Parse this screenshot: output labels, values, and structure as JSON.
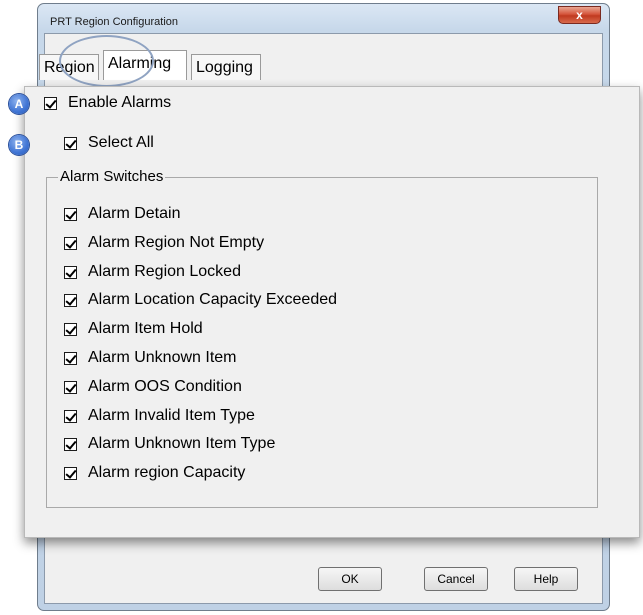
{
  "window": {
    "title": "PRT Region Configuration",
    "close_symbol": "x"
  },
  "tabs": [
    {
      "label": "Region"
    },
    {
      "label": "Alarming"
    },
    {
      "label": "Logging"
    }
  ],
  "annotations": {
    "a": "A",
    "b": "B"
  },
  "enable_alarms": {
    "label": "Enable Alarms",
    "checked": true
  },
  "select_all": {
    "label": "Select All",
    "checked": true
  },
  "alarm_switches": {
    "title": "Alarm Switches",
    "items": [
      {
        "label": "Alarm Detain",
        "checked": true
      },
      {
        "label": "Alarm Region Not Empty",
        "checked": true
      },
      {
        "label": "Alarm Region Locked",
        "checked": true
      },
      {
        "label": "Alarm Location Capacity Exceeded",
        "checked": true
      },
      {
        "label": "Alarm Item Hold",
        "checked": true
      },
      {
        "label": "Alarm Unknown Item",
        "checked": true
      },
      {
        "label": "Alarm OOS Condition",
        "checked": true
      },
      {
        "label": "Alarm Invalid Item Type",
        "checked": true
      },
      {
        "label": "Alarm Unknown Item Type",
        "checked": true
      },
      {
        "label": "Alarm region Capacity",
        "checked": true
      }
    ]
  },
  "buttons": {
    "ok": "OK",
    "cancel": "Cancel",
    "help": "Help"
  },
  "colors": {
    "window_frame": "#c7d8ea",
    "close_button": "#d5553b",
    "badge": "#3f74d4",
    "highlight": "#8fa3c2"
  }
}
